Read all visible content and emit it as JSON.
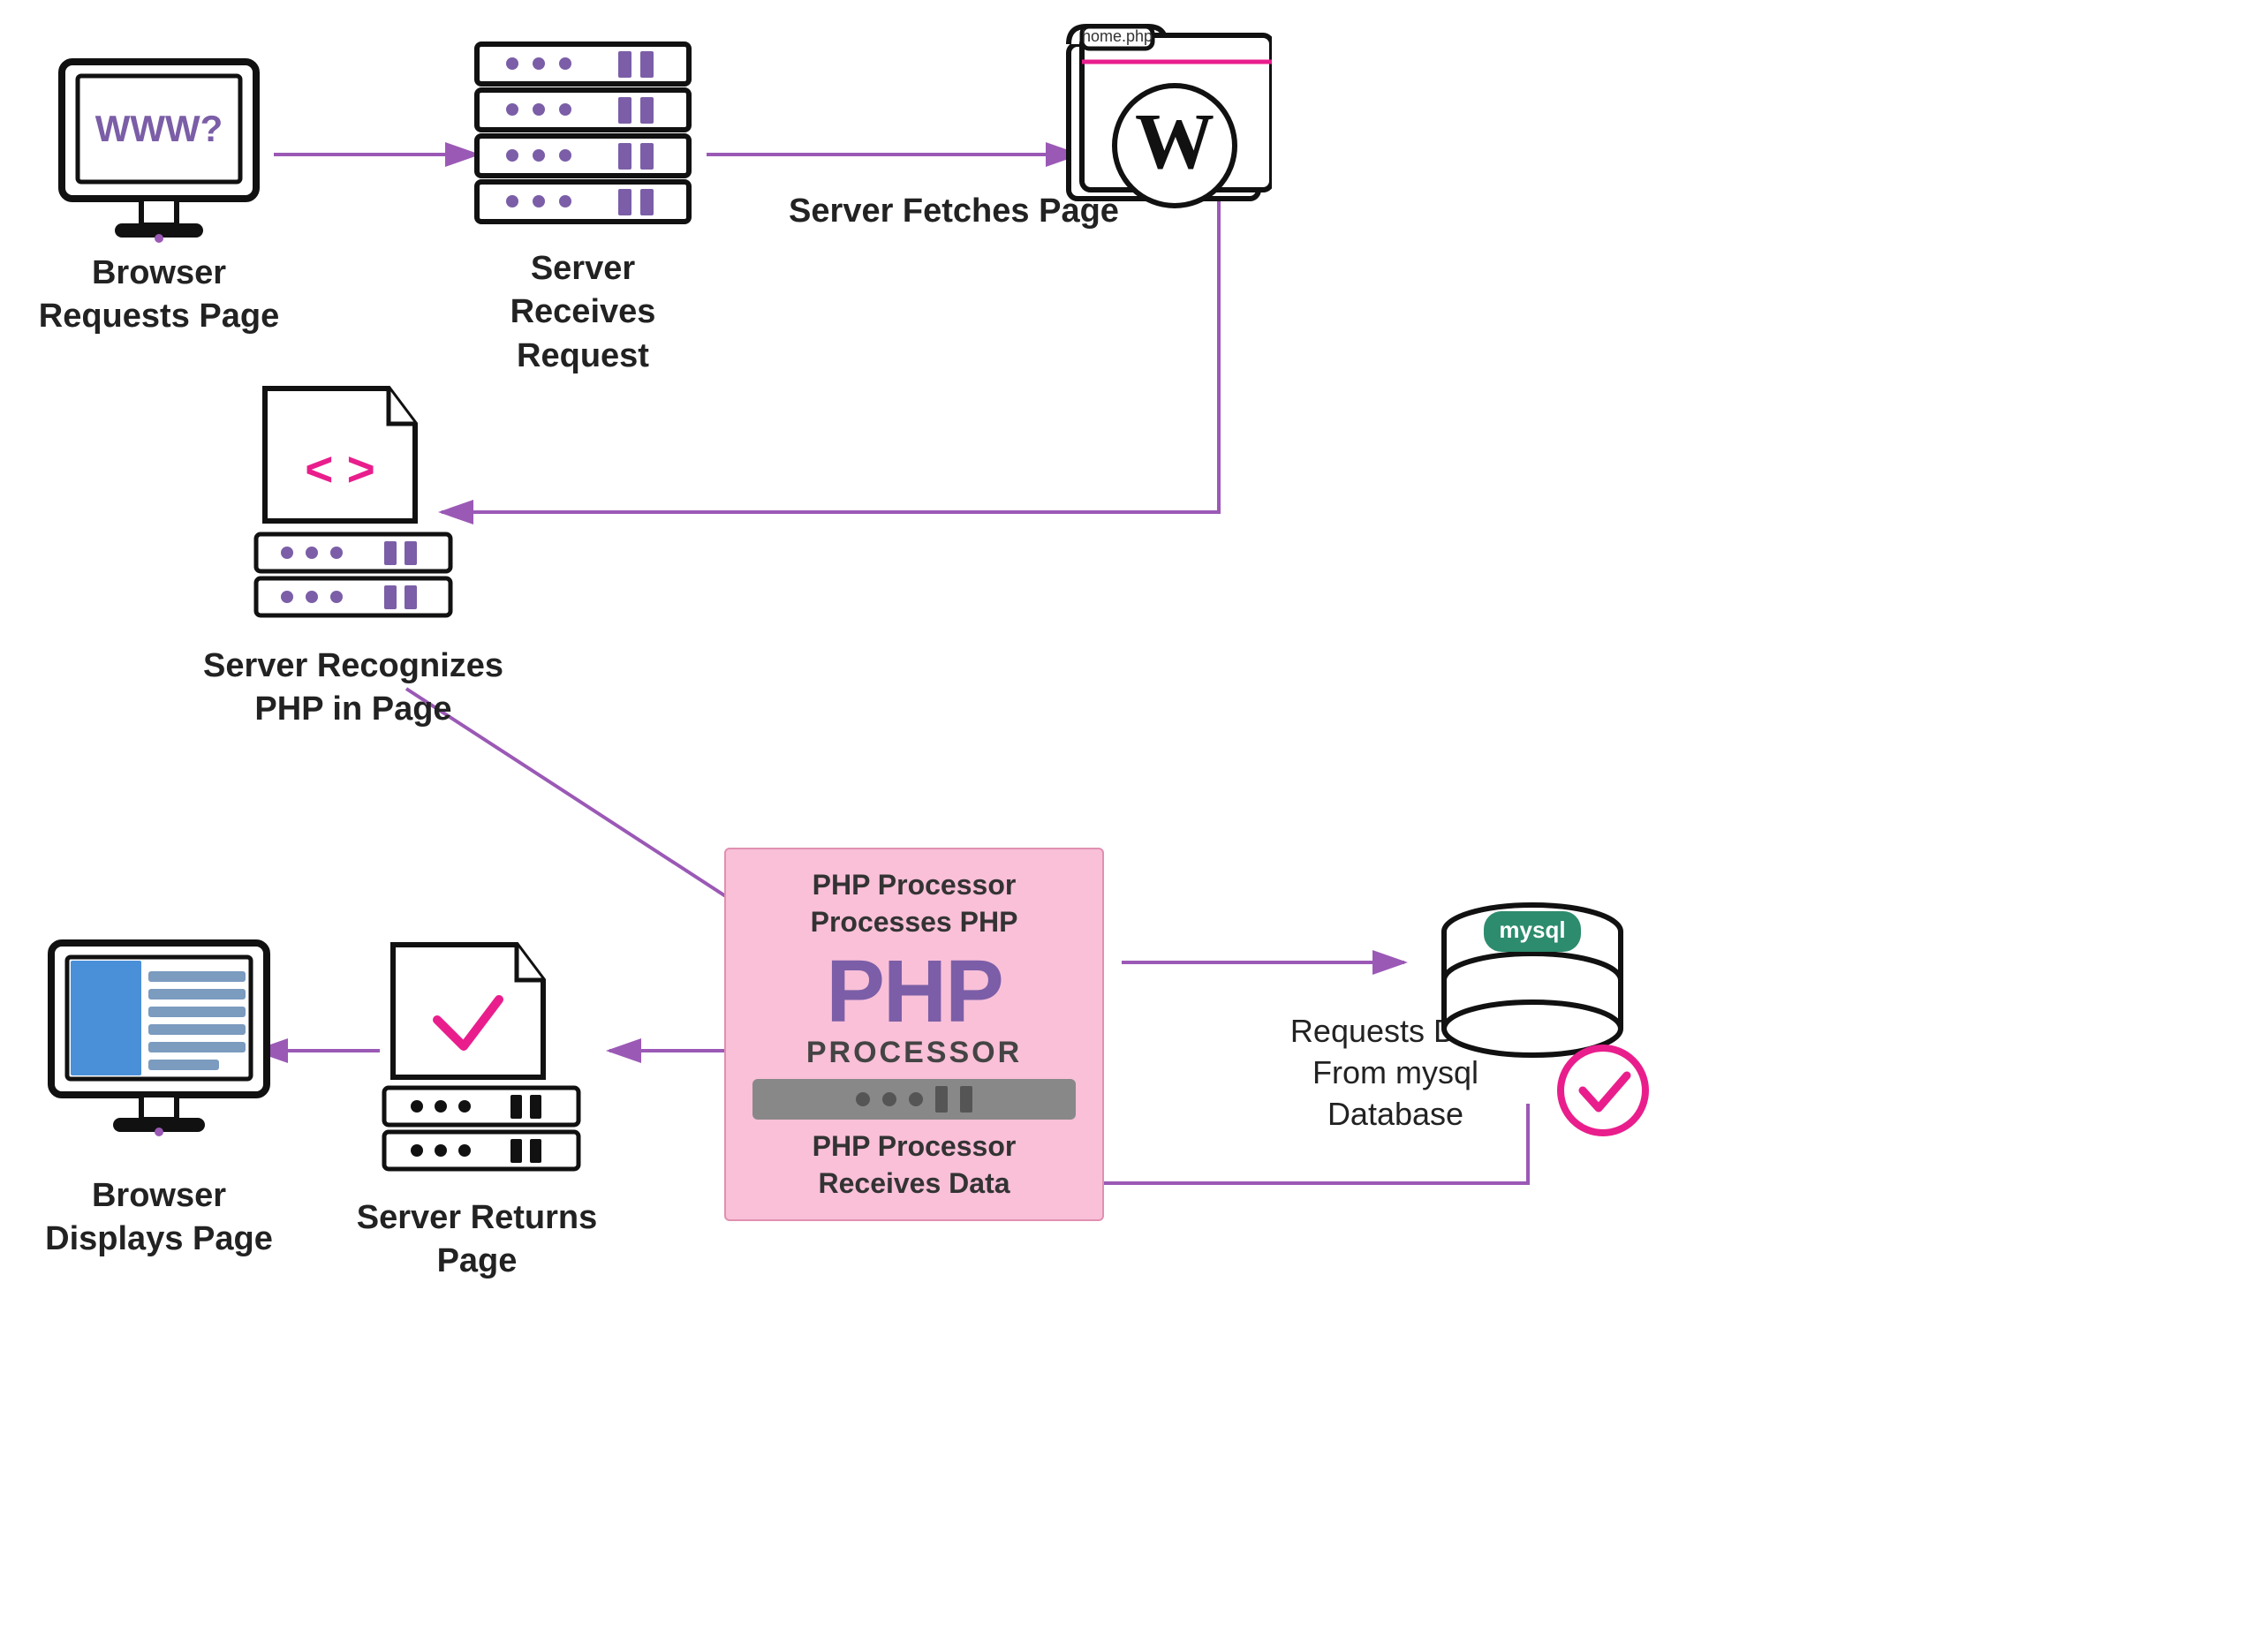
{
  "labels": {
    "browser_requests": "Browser\nRequests Page",
    "server_receives": "Server Receives\nRequest",
    "server_fetches": "Server Fetches Page",
    "server_recognizes": "Server Recognizes\nPHP in Page",
    "php_processor_top": "PHP Processor\nProcesses PHP",
    "php_big": "PHP",
    "php_processor_word": "PROCESSOR",
    "php_processor_bottom": "PHP Processor\nReceives Data",
    "requests_data": "Requests Data\nFrom mysql Database",
    "server_returns": "Server Returns\nPage",
    "browser_displays": "Browser\nDisplays Page",
    "home_php": "home.php"
  },
  "colors": {
    "arrow": "#9b59b6",
    "accent_pink": "#e91e8c",
    "accent_purple": "#7b5ea7",
    "php_box_bg": "#f9c0d8",
    "icon_stroke": "#111",
    "mysql_teal": "#2d8c6e",
    "blue_screen": "#4a90d9",
    "check_green": "#e91e8c"
  }
}
